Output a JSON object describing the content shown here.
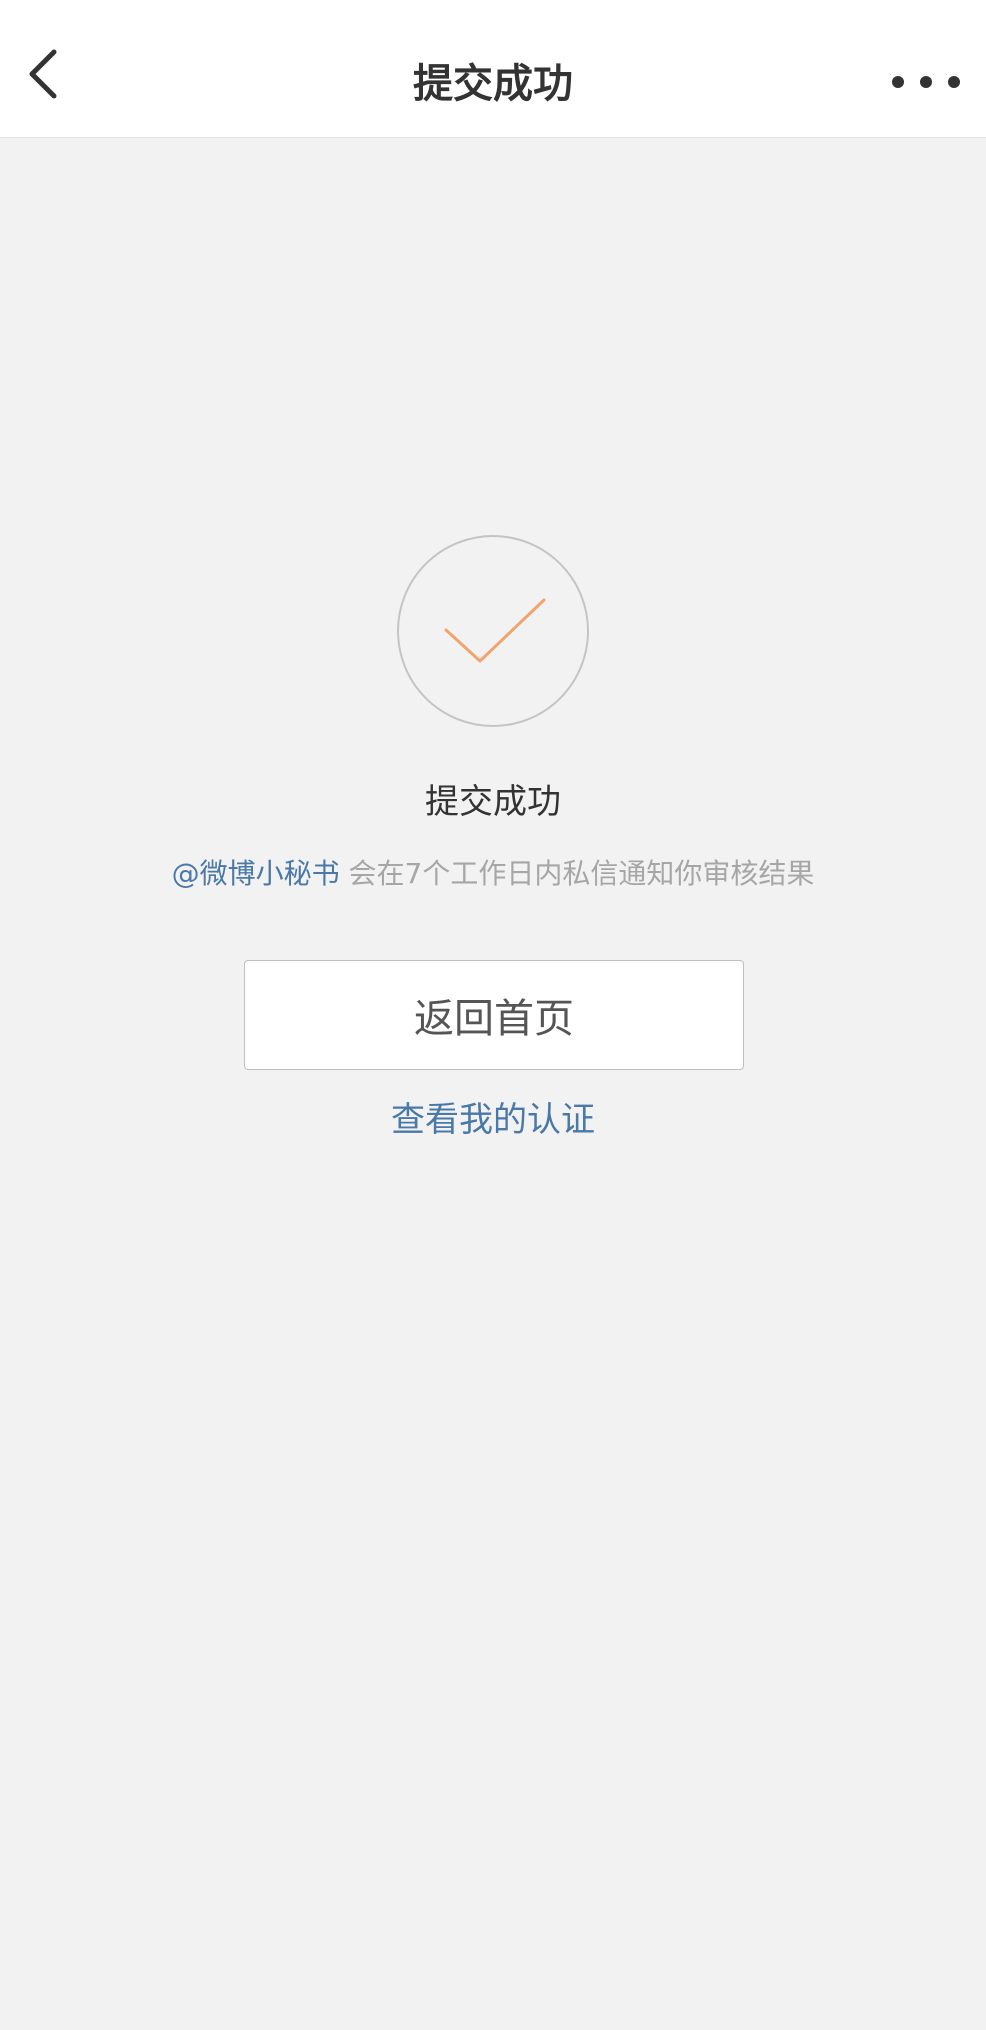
{
  "nav": {
    "title": "提交成功",
    "back_icon": "chevron-left-icon",
    "more_icon": "more-horizontal-icon"
  },
  "success": {
    "icon": "checkmark-icon",
    "title": "提交成功",
    "mention": "@微博小秘书",
    "message": " 会在7个工作日内私信通知你审核结果"
  },
  "actions": {
    "home_button": "返回首页",
    "view_certification_link": "查看我的认证"
  },
  "colors": {
    "accent": "#4a79a8",
    "check": "#f0a46e",
    "background": "#f2f2f2"
  }
}
